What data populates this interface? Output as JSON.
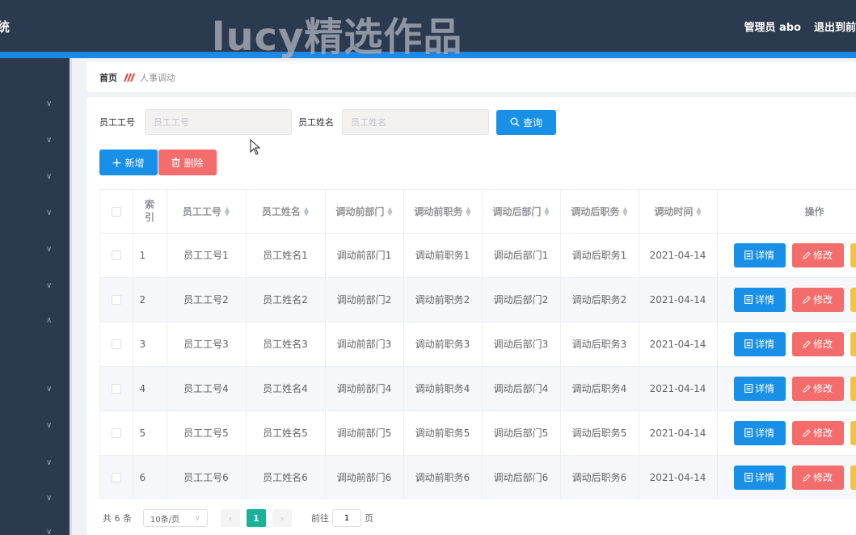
{
  "header": {
    "title_fragment": "统",
    "admin_label": "管理员 abo",
    "logout_label": "退出到前"
  },
  "watermark": "lucy精选作品",
  "breadcrumb": {
    "home": "首页",
    "current": "人事调动"
  },
  "search": {
    "employee_no_label": "员工工号",
    "employee_no_placeholder": "员工工号",
    "employee_name_label": "员工姓名",
    "employee_name_placeholder": "员工姓名",
    "query_label": "查询"
  },
  "actions": {
    "add_label": "新增",
    "delete_label": "删除"
  },
  "table": {
    "columns": [
      "索引",
      "员工工号",
      "员工姓名",
      "调动前部门",
      "调动前职务",
      "调动后部门",
      "调动后职务",
      "调动时间",
      "操作"
    ],
    "rows": [
      {
        "index": "1",
        "no": "员工工号1",
        "name": "员工姓名1",
        "from_dept": "调动前部门1",
        "from_job": "调动前职务1",
        "to_dept": "调动后部门1",
        "to_job": "调动后职务1",
        "date": "2021-04-14"
      },
      {
        "index": "2",
        "no": "员工工号2",
        "name": "员工姓名2",
        "from_dept": "调动前部门2",
        "from_job": "调动前职务2",
        "to_dept": "调动后部门2",
        "to_job": "调动后职务2",
        "date": "2021-04-14"
      },
      {
        "index": "3",
        "no": "员工工号3",
        "name": "员工姓名3",
        "from_dept": "调动前部门3",
        "from_job": "调动前职务3",
        "to_dept": "调动后部门3",
        "to_job": "调动后职务3",
        "date": "2021-04-14"
      },
      {
        "index": "4",
        "no": "员工工号4",
        "name": "员工姓名4",
        "from_dept": "调动前部门4",
        "from_job": "调动前职务4",
        "to_dept": "调动后部门4",
        "to_job": "调动后职务4",
        "date": "2021-04-14"
      },
      {
        "index": "5",
        "no": "员工工号5",
        "name": "员工姓名5",
        "from_dept": "调动前部门5",
        "from_job": "调动前职务5",
        "to_dept": "调动后部门5",
        "to_job": "调动后职务5",
        "date": "2021-04-14"
      },
      {
        "index": "6",
        "no": "员工工号6",
        "name": "员工姓名6",
        "from_dept": "调动前部门6",
        "from_job": "调动前职务6",
        "to_dept": "调动后部门6",
        "to_job": "调动后职务6",
        "date": "2021-04-14"
      }
    ],
    "detail_label": "详情",
    "edit_label": "修改"
  },
  "pagination": {
    "total": "共 6 条",
    "page_size": "10条/页",
    "current_page": "1",
    "goto_prefix": "前往",
    "goto_value": "1",
    "goto_suffix": "页"
  },
  "colors": {
    "topbar": "#2b3a4e",
    "primary": "#1890e8",
    "danger": "#f56c6c",
    "warning": "#f5c242",
    "page_active": "#17b298"
  },
  "icons": {
    "search": "search-icon",
    "plus": "plus-icon",
    "trash": "trash-icon",
    "detail": "document-icon",
    "edit": "pencil-icon",
    "chevron": "chevron-down-icon",
    "sort": "sort-caret-icon"
  }
}
